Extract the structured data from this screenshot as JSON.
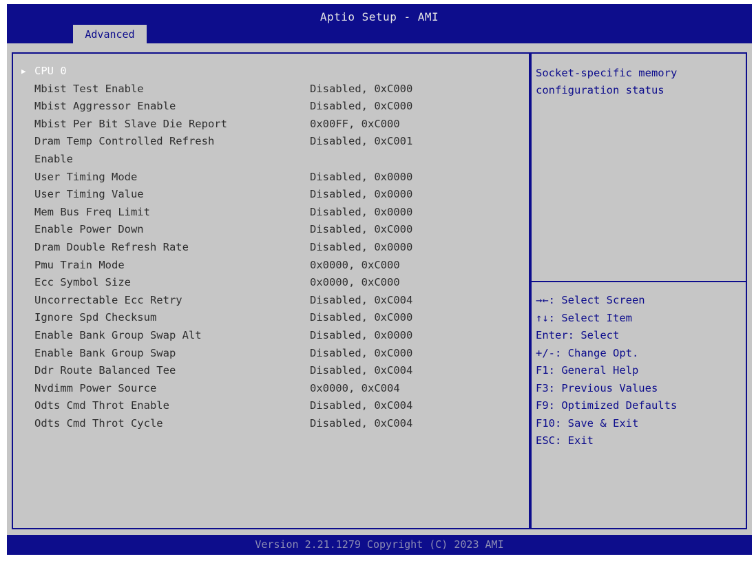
{
  "header": {
    "title": "Aptio Setup - AMI",
    "tab_label": "Advanced"
  },
  "main": {
    "submenu": {
      "arrow": "▶",
      "label": "CPU 0"
    },
    "rows": [
      {
        "label": "Mbist Test Enable",
        "value": "Disabled, 0xC000"
      },
      {
        "label": "Mbist Aggressor Enable",
        "value": "Disabled, 0xC000"
      },
      {
        "label": "Mbist Per Bit Slave Die Report",
        "value": "0x00FF, 0xC000"
      },
      {
        "label": "Dram Temp Controlled Refresh",
        "label_cont": "Enable",
        "value": "Disabled, 0xC001"
      },
      {
        "label": "User Timing Mode",
        "value": "Disabled, 0x0000"
      },
      {
        "label": "User Timing Value",
        "value": "Disabled, 0x0000"
      },
      {
        "label": "Mem Bus Freq Limit",
        "value": "Disabled, 0x0000"
      },
      {
        "label": "Enable Power Down",
        "value": "Disabled, 0xC000"
      },
      {
        "label": "Dram Double Refresh Rate",
        "value": "Disabled, 0x0000"
      },
      {
        "label": "Pmu Train Mode",
        "value": "0x0000, 0xC000"
      },
      {
        "label": "Ecc Symbol Size",
        "value": "0x0000, 0xC000"
      },
      {
        "label": "Uncorrectable Ecc Retry",
        "value": "Disabled, 0xC004"
      },
      {
        "label": "Ignore Spd Checksum",
        "value": "Disabled, 0xC000"
      },
      {
        "label": "Enable Bank Group Swap Alt",
        "value": "Disabled, 0x0000"
      },
      {
        "label": "Enable Bank Group Swap",
        "value": "Disabled, 0xC000"
      },
      {
        "label": "Ddr Route Balanced Tee",
        "value": "Disabled, 0xC004"
      },
      {
        "label": "Nvdimm Power Source",
        "value": "0x0000, 0xC004"
      },
      {
        "label": "Odts Cmd Throt Enable",
        "value": "Disabled, 0xC004"
      },
      {
        "label": "Odts Cmd Throt Cycle",
        "value": "Disabled, 0xC004"
      }
    ]
  },
  "help": {
    "description": "Socket-specific memory\nconfiguration status"
  },
  "keys": [
    "→←: Select Screen",
    "↑↓: Select Item",
    "Enter: Select",
    "+/-: Change Opt.",
    "F1: General Help",
    "F3: Previous Values",
    "F9: Optimized Defaults",
    "F10: Save & Exit",
    "ESC: Exit"
  ],
  "footer": {
    "text": "Version 2.21.1279 Copyright (C) 2023 AMI"
  },
  "colors": {
    "bios_blue": "#0d0d8c",
    "background_gray": "#c6c6c6",
    "selected_white": "#ffffff",
    "text_dark": "#2e2e2e"
  }
}
